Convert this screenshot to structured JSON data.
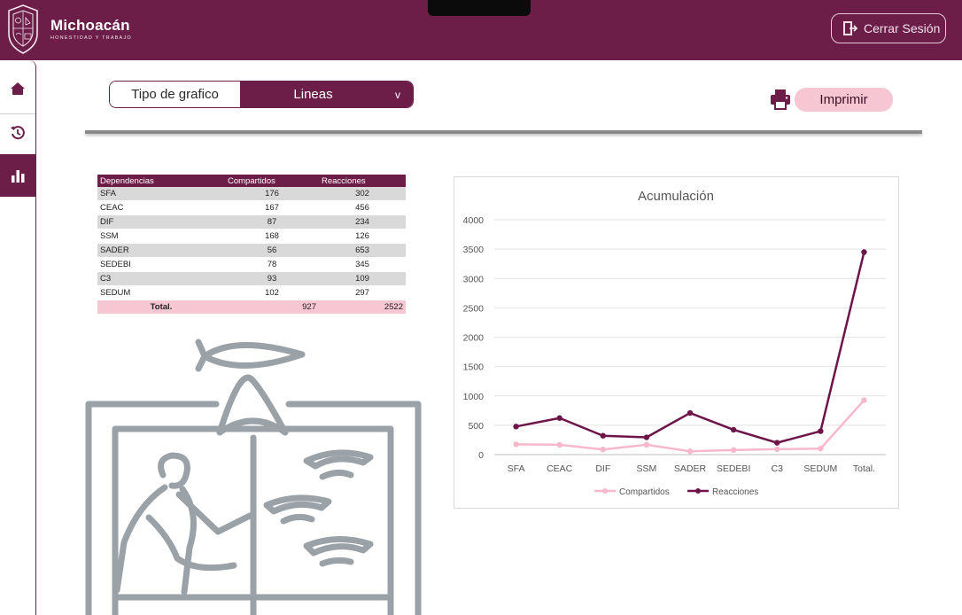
{
  "header": {
    "brand_title": "Michoacán",
    "brand_subtitle": "HONESTIDAD Y TRABAJO",
    "logout_label": "Cerrar Sesión",
    "logout_icon": "logout-door-icon",
    "crest_icon": "state-crest-icon"
  },
  "sidebar": {
    "items": [
      {
        "name": "home",
        "icon": "home-icon",
        "active": false
      },
      {
        "name": "history",
        "icon": "history-icon",
        "active": false
      },
      {
        "name": "charts",
        "icon": "bar-chart-icon",
        "active": true
      }
    ]
  },
  "controls": {
    "chart_type_label": "Tipo de grafico",
    "chart_type_value": "Lineas",
    "chart_type_chevron": "v",
    "print_label": "Imprimir",
    "print_icon": "printer-icon"
  },
  "table": {
    "headers": [
      "Dependencias",
      "Compartidos",
      "Reacciones"
    ],
    "rows": [
      [
        "SFA",
        "176",
        "302"
      ],
      [
        "CEAC",
        "167",
        "456"
      ],
      [
        "DIF",
        "87",
        "234"
      ],
      [
        "SSM",
        "168",
        "126"
      ],
      [
        "SADER",
        "56",
        "653"
      ],
      [
        "SEDEBI",
        "78",
        "345"
      ],
      [
        "C3",
        "93",
        "109"
      ],
      [
        "SEDUM",
        "102",
        "297"
      ]
    ],
    "total": [
      "Total.",
      "927",
      "2522"
    ]
  },
  "colors": {
    "brand": "#6d1e48",
    "accent_pink": "#f7c6d3",
    "series_compartidos": "#f7b8cb",
    "series_reacciones": "#6d1448"
  },
  "chart_data": {
    "type": "line",
    "title": "Acumulación",
    "categories": [
      "SFA",
      "CEAC",
      "DIF",
      "SSM",
      "SADER",
      "SEDEBI",
      "C3",
      "SEDUM",
      "Total."
    ],
    "series": [
      {
        "name": "Compartidos",
        "values": [
          176,
          167,
          87,
          168,
          56,
          78,
          93,
          102,
          927
        ]
      },
      {
        "name": "Reacciones",
        "values": [
          478,
          623,
          321,
          294,
          709,
          423,
          202,
          399,
          3449
        ]
      }
    ],
    "yticks": [
      "0",
      "500",
      "1000",
      "1500",
      "2000",
      "2500",
      "3000",
      "3500",
      "4000"
    ],
    "ylim": [
      0,
      4000
    ],
    "grid": true,
    "legend": "bottom"
  }
}
